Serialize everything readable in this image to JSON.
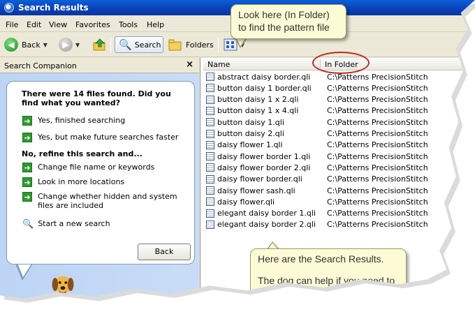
{
  "window": {
    "title": "Search Results"
  },
  "menu": [
    "File",
    "Edit",
    "View",
    "Favorites",
    "Tools",
    "Help"
  ],
  "toolbar": {
    "back": "Back",
    "search": "Search",
    "folders": "Folders"
  },
  "companion": {
    "title": "Search Companion",
    "close": "×",
    "question": "There were 14 files found. Did you find what you wanted?",
    "options_found": [
      "Yes, finished searching",
      "Yes, but make future searches faster"
    ],
    "refine_heading": "No, refine this search and...",
    "options_refine": [
      "Change file name or keywords",
      "Look in more locations",
      "Change whether hidden and system files are included"
    ],
    "new_search": "Start a new search",
    "back_button": "Back"
  },
  "results": {
    "columns": [
      "Name",
      "In Folder"
    ],
    "files": [
      {
        "name": "abstract daisy border.qli",
        "folder": "C:\\Patterns PrecisionStitch"
      },
      {
        "name": "button daisy 1 border.qli",
        "folder": "C:\\Patterns PrecisionStitch"
      },
      {
        "name": "button daisy 1 x 2.qli",
        "folder": "C:\\Patterns PrecisionStitch"
      },
      {
        "name": "button daisy 1 x 4.qli",
        "folder": "C:\\Patterns PrecisionStitch"
      },
      {
        "name": "button daisy 1.qli",
        "folder": "C:\\Patterns PrecisionStitch"
      },
      {
        "name": "button daisy 2.qli",
        "folder": "C:\\Patterns PrecisionStitch"
      },
      {
        "name": "daisy flower 1.qli",
        "folder": "C:\\Patterns PrecisionStitch"
      },
      {
        "name": "daisy flower border 1.qli",
        "folder": "C:\\Patterns PrecisionStitch"
      },
      {
        "name": "daisy flower border 2.qli",
        "folder": "C:\\Patterns PrecisionStitch"
      },
      {
        "name": "daisy flower border.qli",
        "folder": "C:\\Patterns PrecisionStitch"
      },
      {
        "name": "daisy flower sash.qli",
        "folder": "C:\\Patterns PrecisionStitch"
      },
      {
        "name": "daisy flower.qli",
        "folder": "C:\\Patterns PrecisionStitch"
      },
      {
        "name": "elegant daisy border 1.qli",
        "folder": "C:\\Patterns PrecisionStitch"
      },
      {
        "name": "elegant daisy border 2.qli",
        "folder": "C:\\Patterns PrecisionStitch"
      }
    ]
  },
  "callouts": {
    "top": "Look here (In Folder) to find the pattern file",
    "bottom_1": "Here are the Search Results.",
    "bottom_2": "The dog can help if you need to do more searching."
  },
  "colors": {
    "titlebar": "#0a4fc8",
    "pane": "#c4d8f6",
    "callout": "#fdfbd6",
    "highlight": "#c0281e"
  }
}
